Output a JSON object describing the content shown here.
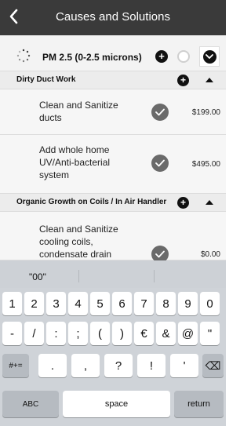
{
  "header": {
    "title": "Causes and Solutions"
  },
  "top_row": {
    "label": "PM 2.5 (0-2.5 microns)"
  },
  "sections": [
    {
      "title": "Dirty Duct Work",
      "items": [
        {
          "desc": "Clean and Sanitize ducts",
          "price": "$199.00"
        },
        {
          "desc": "Add whole home UV/Anti-bacterial system",
          "price": "$495.00"
        }
      ]
    },
    {
      "title": "Organic Growth on Coils / In Air Handler",
      "items": [
        {
          "desc": "Clean and Sanitize cooling coils, condensate drain",
          "price": "$0.00"
        }
      ]
    }
  ],
  "keyboard": {
    "suggestion": "\"00\"",
    "row1": [
      "1",
      "2",
      "3",
      "4",
      "5",
      "6",
      "7",
      "8",
      "9",
      "0"
    ],
    "row2": [
      "-",
      "/",
      ":",
      ";",
      "(",
      ")",
      "€",
      "&",
      "@",
      "\""
    ],
    "row3": [
      ".",
      ",",
      "?",
      "!",
      "'"
    ],
    "mode_label": "#+=",
    "delete_label": "⌫",
    "abc_label": "ABC",
    "space_label": "space",
    "return_label": "return"
  },
  "colors": {
    "header_bg": "#3a3a3a",
    "check_bg": "#6a6a6a",
    "keyboard_bg": "#cfd3d8"
  }
}
